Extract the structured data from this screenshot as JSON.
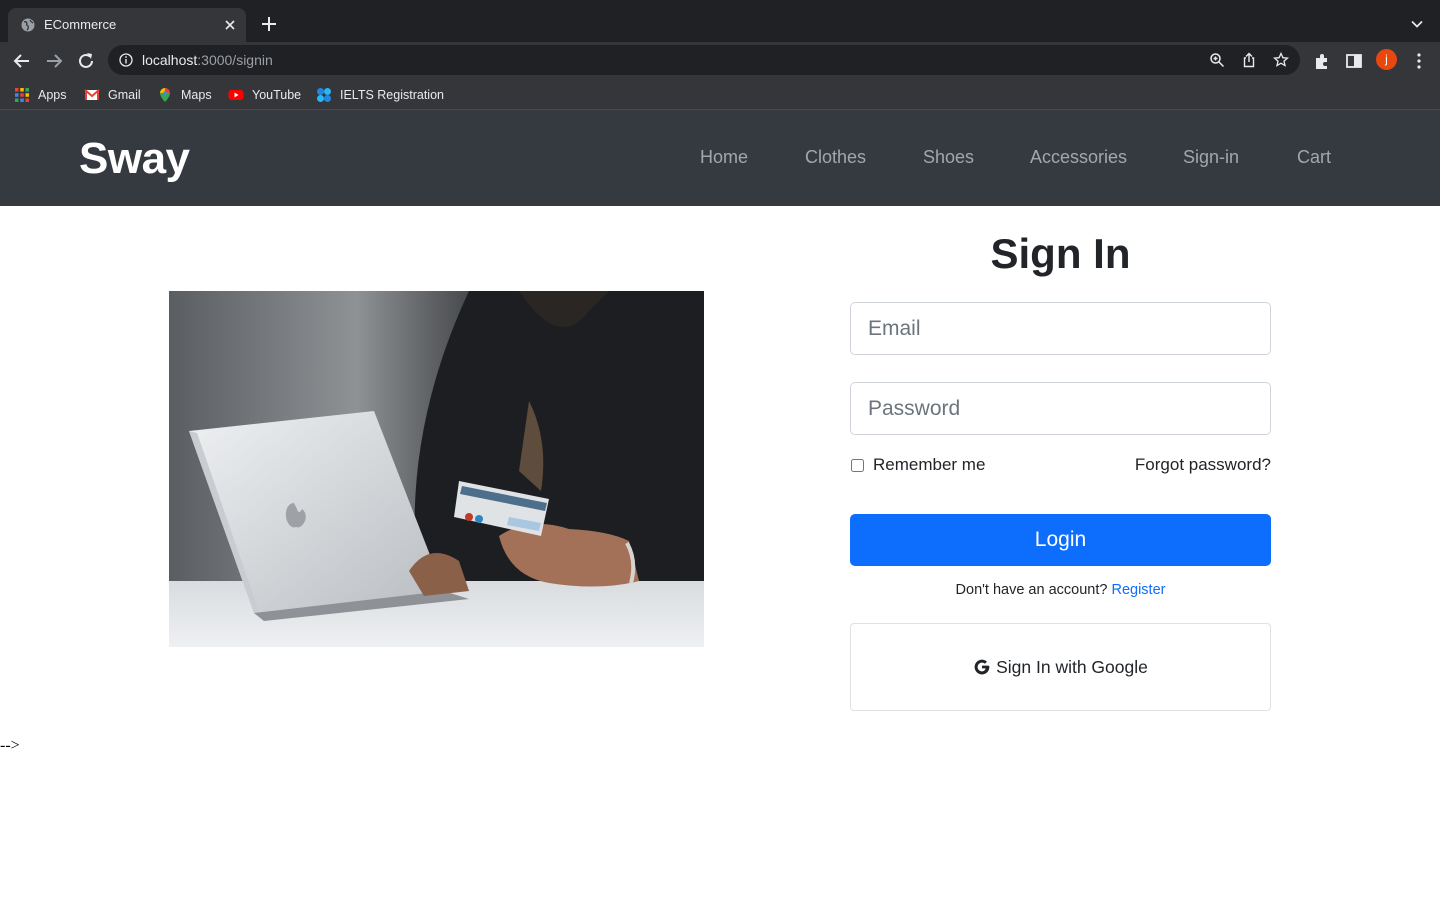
{
  "browser": {
    "tab_title": "ECommerce",
    "url_host": "localhost",
    "url_path": ":3000/signin",
    "profile_initial": "j",
    "bookmarks": [
      {
        "label": "Apps",
        "icon": "apps-grid-icon"
      },
      {
        "label": "Gmail",
        "icon": "gmail-icon"
      },
      {
        "label": "Maps",
        "icon": "maps-icon"
      },
      {
        "label": "YouTube",
        "icon": "youtube-icon"
      },
      {
        "label": "IELTS Registration",
        "icon": "ielts-icon"
      }
    ]
  },
  "nav": {
    "brand": "Sway",
    "links": [
      "Home",
      "Clothes",
      "Shoes",
      "Accessories",
      "Sign-in",
      "Cart"
    ]
  },
  "signin": {
    "title": "Sign In",
    "email_placeholder": "Email",
    "password_placeholder": "Password",
    "remember_label": "Remember me",
    "remember_checked": false,
    "forgot_label": "Forgot password?",
    "login_label": "Login",
    "no_account_text": "Don't have an account?",
    "register_label": "Register",
    "google_label": "Sign In with Google"
  },
  "stray_text": "-->",
  "colors": {
    "nav_bg": "#343a40",
    "primary": "#0d6efd",
    "text": "#212529"
  }
}
